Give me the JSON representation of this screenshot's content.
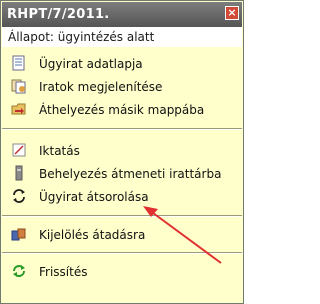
{
  "window": {
    "title": "RHPT/7/2011.",
    "close_glyph": "×",
    "status": "Állapot: ügyintézés alatt"
  },
  "menu": {
    "group1": [
      {
        "label": "Ügyirat adatlapja",
        "icon": "document-icon"
      },
      {
        "label": "Iratok megjelenítése",
        "icon": "documents-view-icon"
      },
      {
        "label": "Áthelyezés másik mappába",
        "icon": "move-folder-icon"
      }
    ],
    "group2": [
      {
        "label": "Iktatás",
        "icon": "register-icon"
      },
      {
        "label": "Behelyezés átmeneti irattárba",
        "icon": "archive-icon"
      },
      {
        "label": "Ügyirat átsorolása",
        "icon": "reassign-icon"
      }
    ],
    "group3": [
      {
        "label": "Kijelölés átadásra",
        "icon": "handover-icon"
      }
    ],
    "group4": [
      {
        "label": "Frissítés",
        "icon": "refresh-icon"
      }
    ]
  },
  "colors": {
    "background": "#ffffcc",
    "titlebar": "#666666",
    "arrow": "#e03030"
  }
}
